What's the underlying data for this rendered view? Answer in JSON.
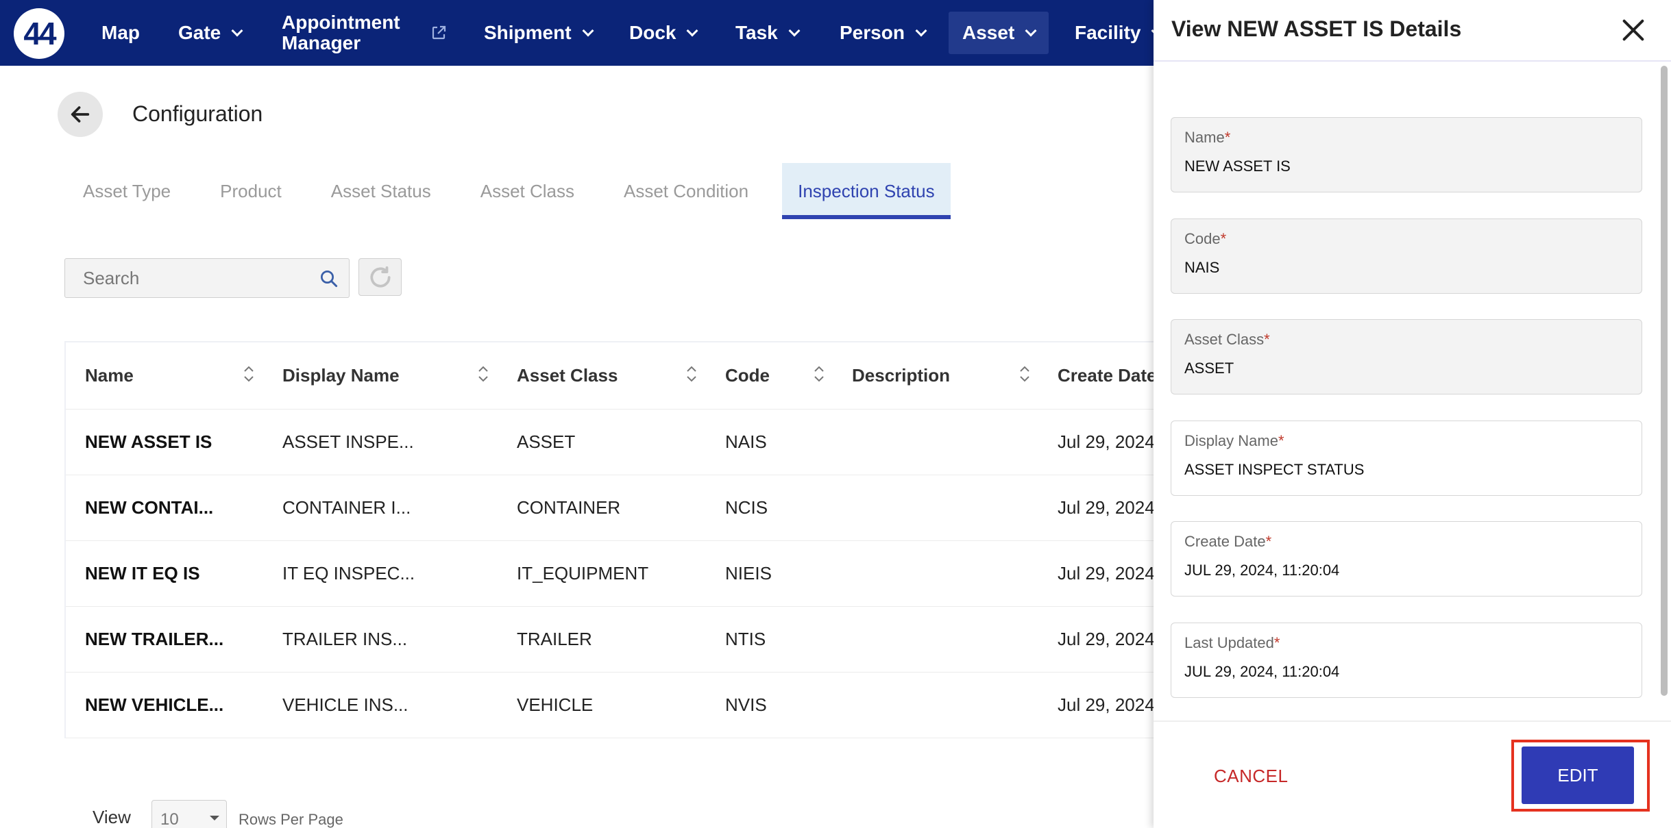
{
  "nav": {
    "logo": "44",
    "items": [
      {
        "label": "Map"
      },
      {
        "label": "Gate"
      },
      {
        "label_line1": "Appointment",
        "label_line2": "Manager"
      },
      {
        "label": "Shipment"
      },
      {
        "label": "Dock"
      },
      {
        "label": "Task"
      },
      {
        "label": "Person"
      },
      {
        "label": "Asset"
      },
      {
        "label": "Facility"
      }
    ]
  },
  "page": {
    "title": "Configuration"
  },
  "tabs": [
    "Asset Type",
    "Product",
    "Asset Status",
    "Asset Class",
    "Asset Condition",
    "Inspection Status"
  ],
  "search": {
    "placeholder": "Search"
  },
  "table": {
    "headers": {
      "name": "Name",
      "display": "Display Name",
      "asset_class": "Asset Class",
      "code": "Code",
      "description": "Description",
      "create_date": "Create Date"
    },
    "rows": [
      {
        "name": "NEW ASSET IS",
        "display": "ASSET INSPE...",
        "asset_class": "ASSET",
        "code": "NAIS",
        "description": "",
        "create_date": "Jul 29, 2024,"
      },
      {
        "name": "NEW CONTAI...",
        "display": "CONTAINER I...",
        "asset_class": "CONTAINER",
        "code": "NCIS",
        "description": "",
        "create_date": "Jul 29, 2024,"
      },
      {
        "name": "NEW IT EQ IS",
        "display": "IT EQ INSPEC...",
        "asset_class": "IT_EQUIPMENT",
        "code": "NIEIS",
        "description": "",
        "create_date": "Jul 29, 2024,"
      },
      {
        "name": "NEW TRAILER...",
        "display": "TRAILER INS...",
        "asset_class": "TRAILER",
        "code": "NTIS",
        "description": "",
        "create_date": "Jul 29, 2024,"
      },
      {
        "name": "NEW VEHICLE...",
        "display": "VEHICLE INS...",
        "asset_class": "VEHICLE",
        "code": "NVIS",
        "description": "",
        "create_date": "Jul 29, 2024,"
      }
    ]
  },
  "pagination": {
    "view_label": "View",
    "rows_value": "10",
    "rows_label": "Rows Per Page"
  },
  "panel": {
    "title": "View NEW ASSET IS Details",
    "fields": [
      {
        "label": "Name",
        "value": "NEW ASSET IS"
      },
      {
        "label": "Code",
        "value": "NAIS"
      },
      {
        "label": "Asset Class",
        "value": "ASSET"
      },
      {
        "label": "Display Name",
        "value": "ASSET INSPECT STATUS"
      },
      {
        "label": "Create Date",
        "value": "JUL 29, 2024, 11:20:04"
      },
      {
        "label": "Last Updated",
        "value": "JUL 29, 2024, 11:20:04"
      }
    ],
    "required_mark": "*",
    "cancel_label": "CANCEL",
    "edit_label": "EDIT"
  },
  "colors": {
    "nav_bg": "#0b2478",
    "accent": "#2f43b0",
    "edit_bg": "#2f3bb5",
    "cancel": "#c62828",
    "highlight": "#e5321f"
  }
}
